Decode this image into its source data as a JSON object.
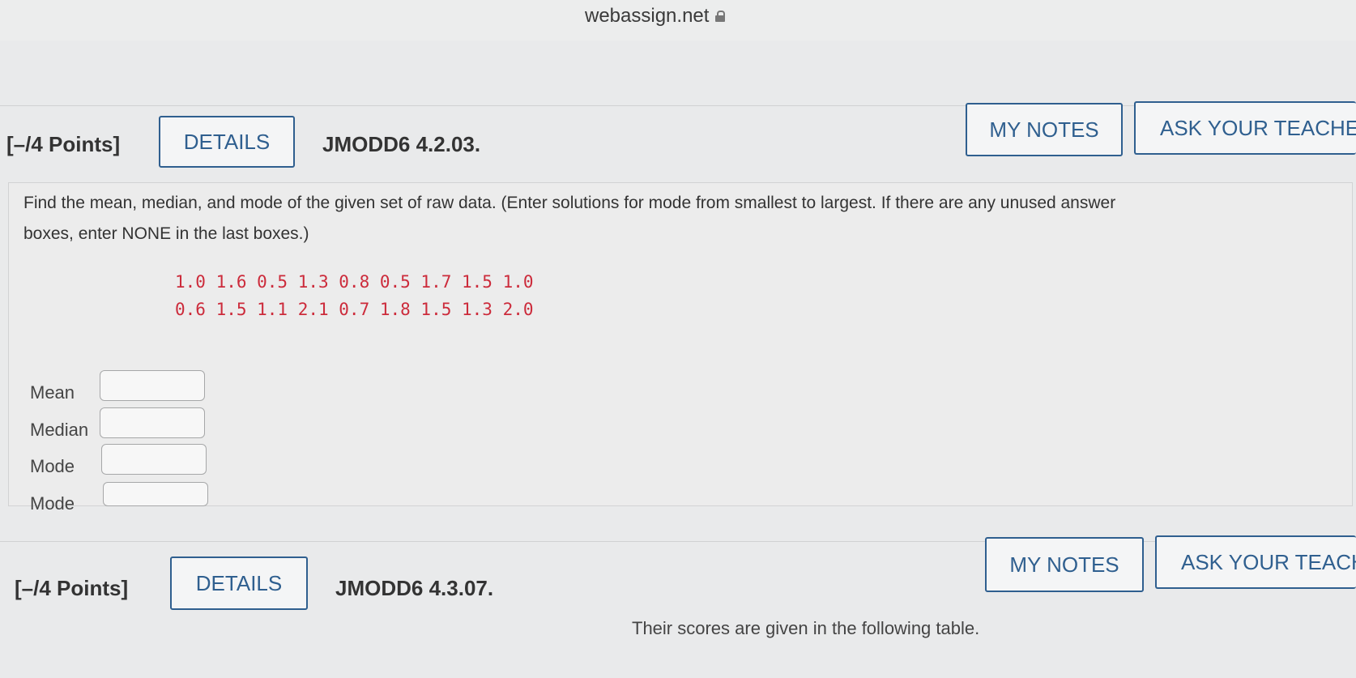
{
  "browser": {
    "url": "webassign.net"
  },
  "question1": {
    "points": "[–/4 Points]",
    "details_label": "DETAILS",
    "code": "JMODD6 4.2.03.",
    "my_notes_label": "MY NOTES",
    "ask_teacher_label": "ASK YOUR TEACHER",
    "prompt_line1": "Find the mean, median, and mode of the given set of raw data. (Enter solutions for mode from smallest to largest. If there are any unused answer",
    "prompt_line2": "boxes, enter NONE in the last boxes.)",
    "data_row1": "1.0 1.6 0.5 1.3 0.8 0.5 1.7 1.5 1.0",
    "data_row2": "0.6 1.5 1.1 2.1 0.7 1.8 1.5 1.3 2.0",
    "answers": [
      {
        "label": "Mean",
        "value": ""
      },
      {
        "label": "Median",
        "value": ""
      },
      {
        "label": "Mode",
        "value": ""
      },
      {
        "label": "Mode",
        "value": ""
      }
    ]
  },
  "question2": {
    "points": "[–/4 Points]",
    "details_label": "DETAILS",
    "code": "JMODD6 4.3.07.",
    "my_notes_label": "MY NOTES",
    "ask_teacher_label": "ASK YOUR TEACH",
    "partial_text": "Their scores are given in the following table."
  }
}
